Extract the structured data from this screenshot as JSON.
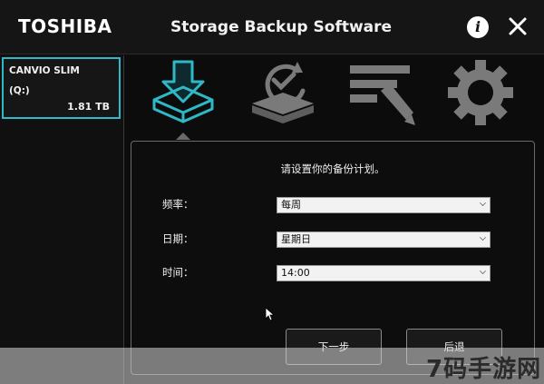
{
  "titlebar": {
    "brand": "TOSHIBA",
    "title": "Storage Backup Software",
    "info_icon": "i"
  },
  "sidebar": {
    "device": {
      "name": "CANVIO SLIM",
      "drive": "(Q:)",
      "size": "1.81 TB"
    }
  },
  "nav": {
    "items": [
      {
        "icon": "backup-download-icon",
        "active": true
      },
      {
        "icon": "restore-check-icon",
        "active": false
      },
      {
        "icon": "edit-list-icon",
        "active": false
      },
      {
        "icon": "settings-gear-icon",
        "active": false
      }
    ],
    "accent": "#2fb8c6",
    "inactive_color": "#7a7a7a"
  },
  "schedule": {
    "prompt": "请设置你的备份计划。",
    "frequency_label": "频率：",
    "frequency_value": "每周",
    "date_label": "日期：",
    "date_value": "星期日",
    "time_label": "时间：",
    "time_value": "14:00",
    "next_button": "下一步",
    "back_button": "后退"
  },
  "watermark": "7码手游网"
}
